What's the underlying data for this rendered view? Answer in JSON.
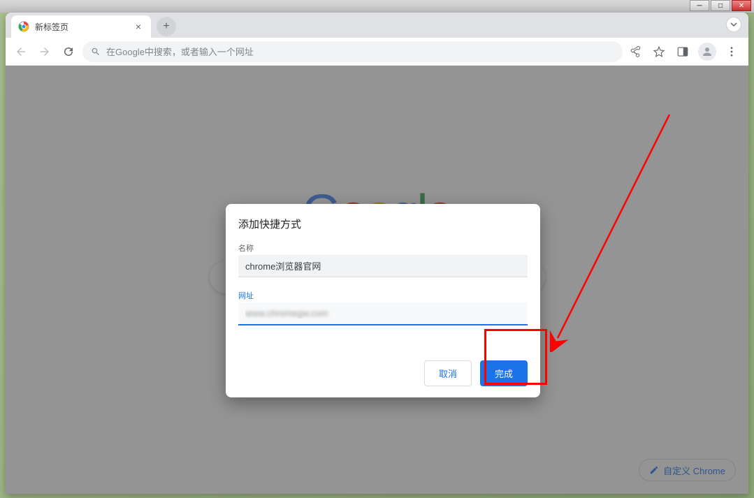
{
  "window": {
    "tab_title": "新标签页"
  },
  "omnibox": {
    "placeholder": "在Google中搜索，或者输入一个网址"
  },
  "logo": {
    "g1": "G",
    "o1": "o",
    "o2": "o",
    "g2": "g",
    "l": "l",
    "e": "e"
  },
  "modal": {
    "title": "添加快捷方式",
    "name_label": "名称",
    "name_value": "chrome浏览器官网",
    "url_label": "网址",
    "url_value": "www.chromegw.com",
    "cancel": "取消",
    "done": "完成"
  },
  "customize": {
    "label": "自定义 Chrome"
  }
}
